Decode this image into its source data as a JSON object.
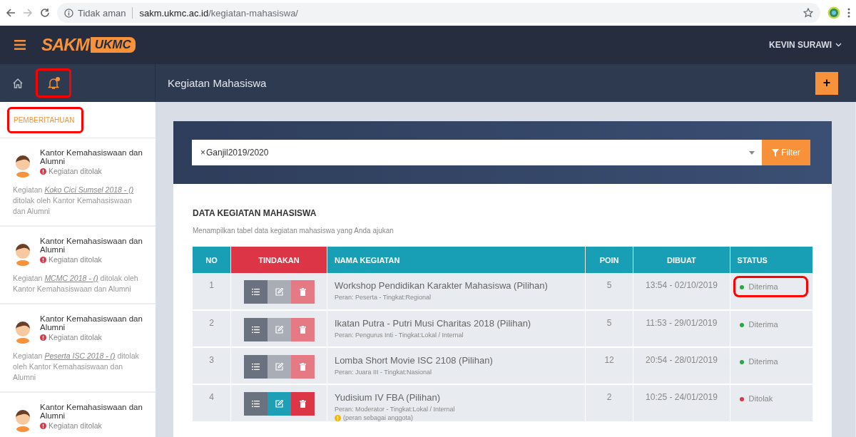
{
  "browser": {
    "security": "Tidak aman",
    "url_domain": "sakm.ukmc.ac.id",
    "url_path": "/kegiatan-mahasiswa/"
  },
  "topbar": {
    "logo_main": "SAKM",
    "logo_tag": "UKMC",
    "user": "KEVIN SURAWI"
  },
  "subbar": {
    "notification_unread": true,
    "bell_highlighted": true,
    "page_title": "Kegiatan Mahasiswa",
    "add_label": "+"
  },
  "sidebar": {
    "heading": "PEMBERITAHUAN",
    "heading_highlighted": true,
    "notifications": [
      {
        "sender": "Kantor Kemahasiswaan dan Alumni",
        "status": "Kegiatan ditolak",
        "message_prefix": "Kegiatan ",
        "link": "Koko Cici Sumsel 2018 - ()",
        "message_suffix": " ditolak oleh Kantor Kemahasiswaan dan Alumni"
      },
      {
        "sender": "Kantor Kemahasiswaan dan Alumni",
        "status": "Kegiatan ditolak",
        "message_prefix": "Kegiatan ",
        "link": "MCMC 2018 - ()",
        "message_suffix": " ditolak oleh Kantor Kemahasiswaan dan Alumni"
      },
      {
        "sender": "Kantor Kemahasiswaan dan Alumni",
        "status": "Kegiatan ditolak",
        "message_prefix": "Kegiatan ",
        "link": "Peserta ISC 2018 - ()",
        "message_suffix": " ditolak oleh Kantor Kemahasiswaan dan Alumni"
      },
      {
        "sender": "Kantor Kemahasiswaan dan Alumni",
        "status": "Kegiatan ditolak"
      }
    ]
  },
  "filter": {
    "tag_remove": "×",
    "value": "Ganjil2019/2020",
    "button": "Filter"
  },
  "section": {
    "title": "DATA KEGIATAN MAHASISWA",
    "subtitle": "Menampilkan tabel data kegiatan mahasiswa yang Anda ajukan"
  },
  "table": {
    "columns": [
      "NO",
      "TINDAKAN",
      "NAMA KEGIATAN",
      "POIN",
      "DIBUAT",
      "STATUS"
    ],
    "rows": [
      {
        "no": "1",
        "editable": false,
        "name": "Workshop Pendidikan Karakter Mahasiswa (Pilihan)",
        "detail": "Peran: Peserta - Tingkat:Regional",
        "poin": "5",
        "dibuat": "13:54 - 02/10/2019",
        "status": "Diterima",
        "color": "#28a745",
        "highlighted": true
      },
      {
        "no": "2",
        "editable": false,
        "name": "Ikatan Putra - Putri Musi Charitas 2018 (Pilihan)",
        "detail": "Peran: Pengurus Inti - Tingkat:Lokal / Internal",
        "poin": "5",
        "dibuat": "11:53 - 29/01/2019",
        "status": "Diterima",
        "color": "#28a745",
        "highlighted": false
      },
      {
        "no": "3",
        "editable": false,
        "name": "Lomba Short Movie ISC 2108 (Pilihan)",
        "detail": "Peran: Juara III - Tingkat:Nasional",
        "poin": "12",
        "dibuat": "20:54 - 28/01/2019",
        "status": "Diterima",
        "color": "#28a745",
        "highlighted": false
      },
      {
        "no": "4",
        "editable": true,
        "name": "Yudisium IV FBA (Pilihan)",
        "detail": "Peran: Moderator - Tingkat:Lokal / Internal",
        "note": "(peran sebagai anggota)",
        "poin": "2",
        "dibuat": "10:25 - 24/01/2019",
        "status": "Ditolak",
        "color": "#dc3545",
        "highlighted": false
      }
    ]
  }
}
